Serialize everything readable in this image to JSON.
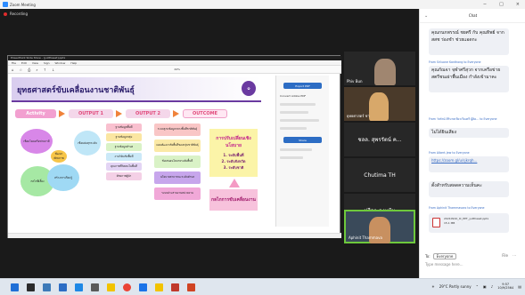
{
  "window": {
    "title": "Zoom Meeting",
    "controls": [
      "−",
      "□",
      "×"
    ]
  },
  "recording": {
    "label": "Recording"
  },
  "ppt": {
    "title": "PowerPoint Slide Show - [yutthasat].pptx",
    "menu": [
      "File",
      "Edit",
      "View",
      "Sign",
      "Window",
      "Help"
    ],
    "zoom": "44%"
  },
  "slide": {
    "title": "ยุทธศาสตร์ขับเคลื่อนงานชาติพันธุ์",
    "chips": [
      "Activity",
      "OUTPUT 1",
      "OUTPUT 2",
      "OUTCOME"
    ],
    "col1": [
      "ฐานข้อมูลพื้นที่",
      "ฐานข้อมูลกลุ่ม",
      "ฐานข้อมูลตำบล",
      "งานวิจัยเชิงพื้นที่",
      "คุณภาพชีวิตคนในพื้นที่",
      "ศักยภาพผู้นำ"
    ],
    "col2": [
      "ระบบฐานข้อมูลกลางพื้นที่ชาติพันธุ์",
      "แผนพัฒนาเชิงพื้นที่ของกลุ่มชาติพันธุ์",
      "ข้อเสนอนโยบายระดับพื้นที่",
      "นโยบายสาธารณะระดับตำบล",
      "ระบบประสานงานหน่วยงาน"
    ],
    "outcome": {
      "title": "การปรับเปลี่ยนเชิงนโยบาย",
      "items": [
        "1. ระดับพื้นที่",
        "2. ระดับจังหวัด",
        "3. ระดับชาติ"
      ]
    },
    "mechanism": "กลไกการขับเคลื่อนงาน",
    "circles": [
      "เชื่อมโยงเครือข่ายภาคี",
      "พัฒนาศักยภาพ",
      "กลไกพี่เลี้ยง",
      "สร้างการเรียนรู้",
      "เชื่อมต่อทุกระดับ"
    ]
  },
  "pdf_side": {
    "btn1": "Export PDF",
    "btn2": "Share",
    "label": "Convert Adobe PDF"
  },
  "participants": [
    {
      "name": "Phiv Bun"
    },
    {
      "name": "ยุทธศาสตร์ ชา"
    },
    {
      "name": "ชลล. สุพรรัตน์ ค..."
    },
    {
      "name": "Chutima TH"
    },
    {
      "name": "ปรีดา คงแป้น"
    },
    {
      "name": "Aphinit Thammava"
    }
  ],
  "chat": {
    "header": "Chat",
    "messages": [
      {
        "from": "",
        "text": "คุณกนกพรรณ์ ชยศรี กับ คุณทิพย์ จาก สสช ร่องชำ ช่วยแอดกะ"
      },
      {
        "from": "From Sriluone Kanthong to Everyone",
        "text": "คุณกัณจา จุฬาศรีสุวก จากเครือข่ายสตรีชนเผ่าพื้นเมือง กำลังเข้ามาคะ"
      },
      {
        "from": "From วัลรัตน์ ศิริมาศเขียวเรียงศรี ผู้ติด... to Everyone",
        "text": "ไม่ได้ยินเสียง"
      },
      {
        "from": "From Albert-Jew to Everyone",
        "text": "https://zoom.gl/u/sjkrqh..."
      },
      {
        "from": "",
        "text": "ตั้งสำหรับสลดความเห็นคะ"
      },
      {
        "from": "From Aphinit Thammavaro to Everyone",
        "text": ""
      }
    ],
    "file": {
      "name": "20210910_IC_PPT_yutthasat.pptx",
      "size": "15.1 MB"
    },
    "to_label": "To:",
    "to_value": "Everyone",
    "file_label": "File",
    "input_placeholder": "Type message here..."
  },
  "tray": {
    "weather": "29°C Partly sunny",
    "time": "9:57",
    "date": "10/9/2564"
  }
}
